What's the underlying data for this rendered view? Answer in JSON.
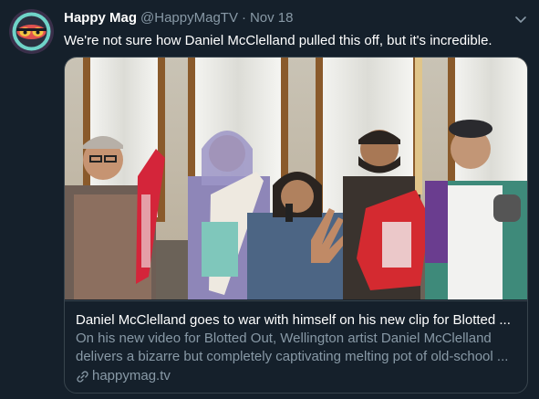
{
  "tweet": {
    "display_name": "Happy Mag",
    "handle": "@HappyMagTV",
    "separator": "·",
    "time": "Nov 18",
    "text": "We're not sure how Daniel McClelland pulled this off, but it's incredible."
  },
  "card": {
    "title": "Daniel McClelland goes to war with himself on his new clip for Blotted ...",
    "description_line1": "On his new video for Blotted Out, Wellington artist Daniel McClelland",
    "description_line2": "delivers a bizarre but completely captivating melting pot of old-school ...",
    "domain": "happymag.tv"
  },
  "icons": {
    "caret": "chevron-down-icon",
    "link": "link-icon"
  },
  "colors": {
    "background": "#15202b",
    "secondary_text": "#8899a6",
    "border": "#38444d"
  }
}
